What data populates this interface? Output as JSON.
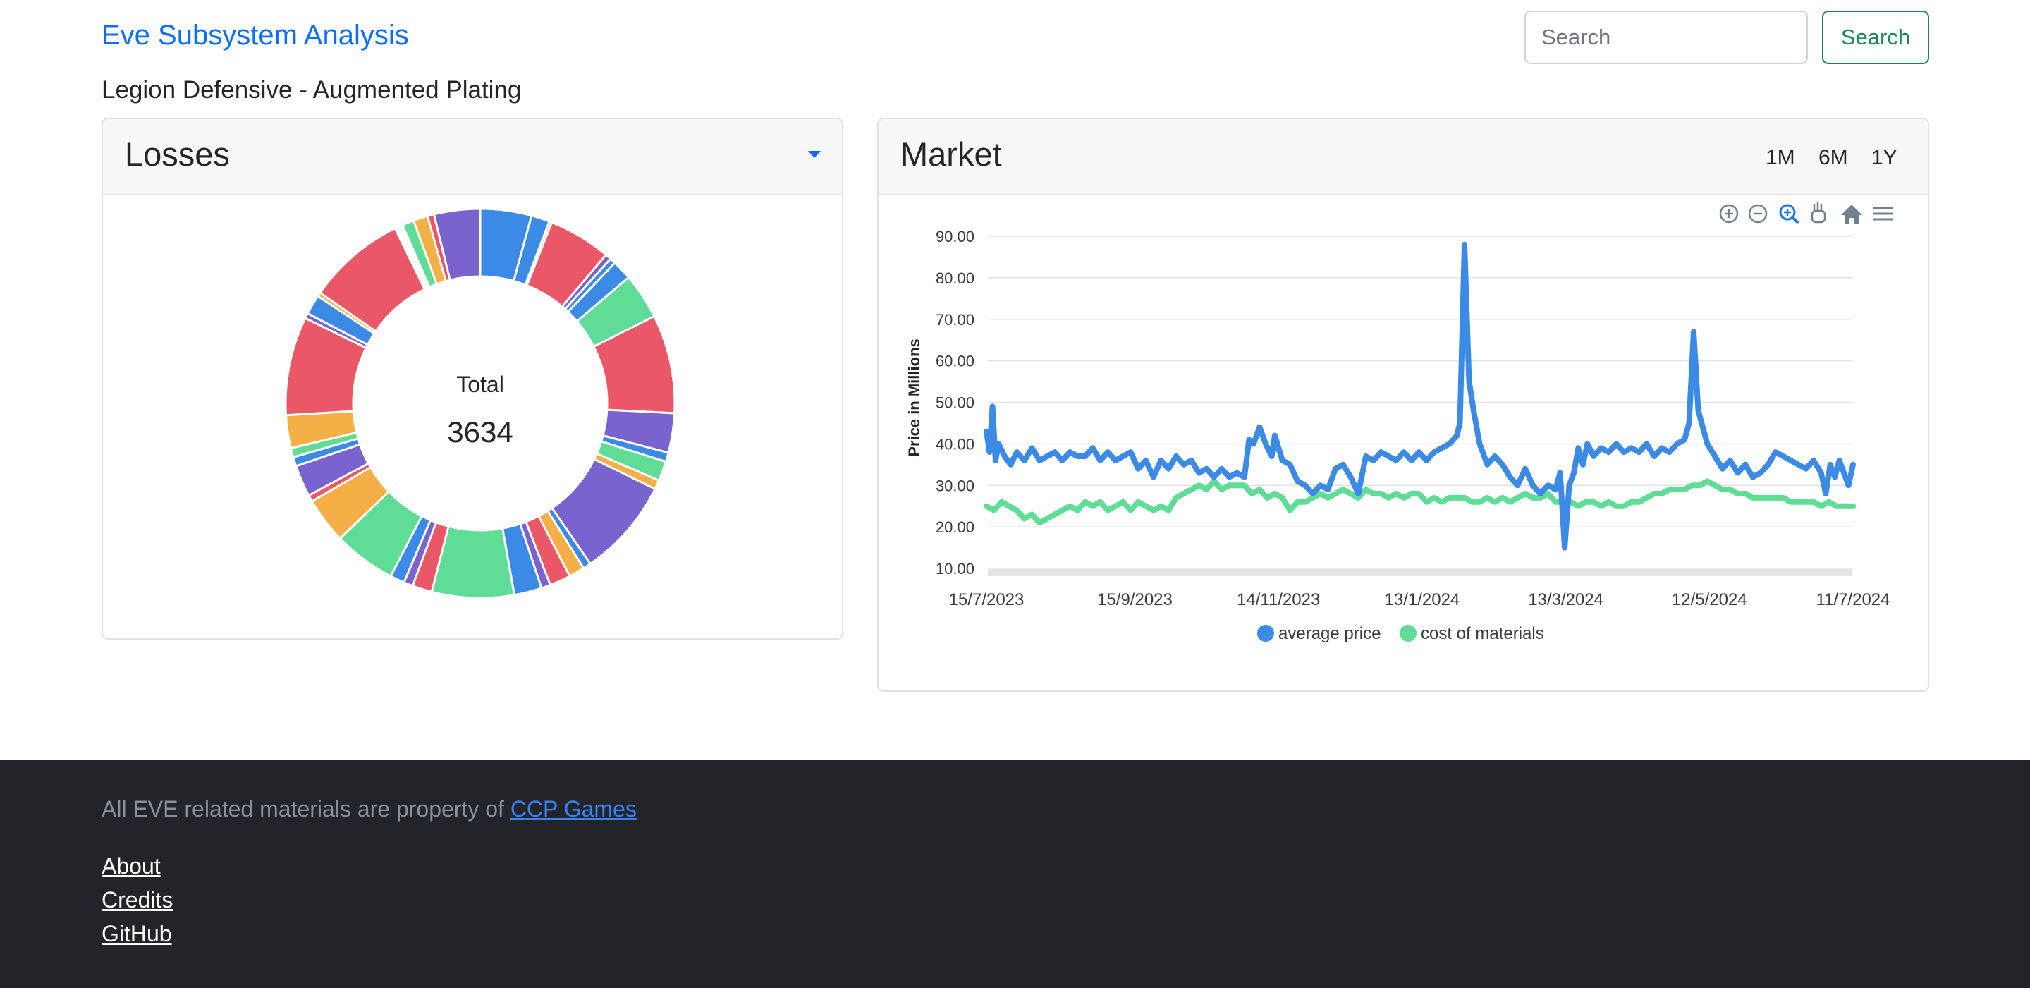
{
  "header": {
    "brand": "Eve Subsystem Analysis",
    "search_placeholder": "Search",
    "search_button": "Search"
  },
  "page_title": "Legion Defensive - Augmented Plating",
  "losses": {
    "title": "Losses",
    "center_label": "Total",
    "total": "3634",
    "colors": [
      "#3b8ae6",
      "#ea5767",
      "#7a62cf",
      "#5fdd96",
      "#f4b046"
    ],
    "segments": [
      {
        "value": 78,
        "color": "#3b8ae6"
      },
      {
        "value": 28,
        "color": "#3b8ae6"
      },
      {
        "value": 4,
        "color": "#f4b046"
      },
      {
        "value": 95,
        "color": "#ea5767"
      },
      {
        "value": 9,
        "color": "#7a62cf"
      },
      {
        "value": 9,
        "color": "#3b8ae6"
      },
      {
        "value": 30,
        "color": "#3b8ae6"
      },
      {
        "value": 70,
        "color": "#5fdd96"
      },
      {
        "value": 150,
        "color": "#ea5767"
      },
      {
        "value": 60,
        "color": "#7a62cf"
      },
      {
        "value": 14,
        "color": "#3b8ae6"
      },
      {
        "value": 30,
        "color": "#5fdd96"
      },
      {
        "value": 14,
        "color": "#f4b046"
      },
      {
        "value": 150,
        "color": "#7a62cf"
      },
      {
        "value": 12,
        "color": "#3b8ae6"
      },
      {
        "value": 24,
        "color": "#f4b046"
      },
      {
        "value": 32,
        "color": "#ea5767"
      },
      {
        "value": 14,
        "color": "#7a62cf"
      },
      {
        "value": 42,
        "color": "#3b8ae6"
      },
      {
        "value": 125,
        "color": "#5fdd96"
      },
      {
        "value": 30,
        "color": "#ea5767"
      },
      {
        "value": 14,
        "color": "#7a62cf"
      },
      {
        "value": 22,
        "color": "#3b8ae6"
      },
      {
        "value": 95,
        "color": "#5fdd96"
      },
      {
        "value": 70,
        "color": "#f4b046"
      },
      {
        "value": 10,
        "color": "#ea5767"
      },
      {
        "value": 48,
        "color": "#7a62cf"
      },
      {
        "value": 14,
        "color": "#3b8ae6"
      },
      {
        "value": 14,
        "color": "#5fdd96"
      },
      {
        "value": 50,
        "color": "#f4b046"
      },
      {
        "value": 150,
        "color": "#ea5767"
      },
      {
        "value": 8,
        "color": "#7a62cf"
      },
      {
        "value": 30,
        "color": "#3b8ae6"
      },
      {
        "value": 6,
        "color": "#f4b046"
      },
      {
        "value": 150,
        "color": "#ea5767"
      },
      {
        "value": 12,
        "color": "#ffffff"
      },
      {
        "value": 18,
        "color": "#5fdd96"
      },
      {
        "value": 22,
        "color": "#f4b046"
      },
      {
        "value": 10,
        "color": "#ea5767"
      },
      {
        "value": 70,
        "color": "#7a62cf"
      }
    ]
  },
  "market": {
    "title": "Market",
    "ranges": [
      "1M",
      "6M",
      "1Y"
    ],
    "toolbar_icons": [
      "zoom-in-icon",
      "zoom-out-icon",
      "zoom-select-icon",
      "pan-hand-icon",
      "home-icon",
      "menu-icon"
    ]
  },
  "chart_data": {
    "type": "line",
    "ylabel": "Price in Millions",
    "ylim": [
      10,
      90
    ],
    "yticks": [
      "90.00",
      "80.00",
      "70.00",
      "60.00",
      "50.00",
      "40.00",
      "30.00",
      "20.00",
      "10.00"
    ],
    "xticks": [
      "15/7/2023",
      "15/9/2023",
      "14/11/2023",
      "13/1/2024",
      "13/3/2024",
      "12/5/2024",
      "11/7/2024"
    ],
    "x_start": "15/7/2023",
    "x_end": "11/7/2024",
    "legend_position": "bottom",
    "series": [
      {
        "name": "average price",
        "color": "#3b8ae6",
        "points": [
          [
            0,
            43
          ],
          [
            2,
            38
          ],
          [
            4,
            49
          ],
          [
            6,
            36
          ],
          [
            8,
            40
          ],
          [
            12,
            37
          ],
          [
            16,
            35
          ],
          [
            20,
            38
          ],
          [
            25,
            36
          ],
          [
            30,
            39
          ],
          [
            35,
            36
          ],
          [
            40,
            37
          ],
          [
            45,
            38
          ],
          [
            50,
            36
          ],
          [
            55,
            38
          ],
          [
            60,
            37
          ],
          [
            65,
            37
          ],
          [
            70,
            39
          ],
          [
            75,
            36
          ],
          [
            80,
            38
          ],
          [
            85,
            36
          ],
          [
            90,
            37
          ],
          [
            95,
            38
          ],
          [
            100,
            34
          ],
          [
            105,
            36
          ],
          [
            110,
            32
          ],
          [
            115,
            36
          ],
          [
            120,
            34
          ],
          [
            125,
            37
          ],
          [
            130,
            35
          ],
          [
            135,
            36
          ],
          [
            140,
            33
          ],
          [
            145,
            34
          ],
          [
            150,
            32
          ],
          [
            155,
            34
          ],
          [
            160,
            32
          ],
          [
            165,
            33
          ],
          [
            170,
            32
          ],
          [
            173,
            41
          ],
          [
            176,
            40
          ],
          [
            180,
            44
          ],
          [
            184,
            40
          ],
          [
            188,
            37
          ],
          [
            190,
            42
          ],
          [
            195,
            36
          ],
          [
            200,
            35
          ],
          [
            205,
            31
          ],
          [
            210,
            30
          ],
          [
            215,
            28
          ],
          [
            220,
            30
          ],
          [
            225,
            29
          ],
          [
            230,
            34
          ],
          [
            235,
            35
          ],
          [
            240,
            32
          ],
          [
            245,
            28
          ],
          [
            250,
            37
          ],
          [
            255,
            36
          ],
          [
            260,
            38
          ],
          [
            265,
            37
          ],
          [
            270,
            36
          ],
          [
            275,
            38
          ],
          [
            280,
            36
          ],
          [
            285,
            38
          ],
          [
            290,
            36
          ],
          [
            295,
            38
          ],
          [
            300,
            39
          ],
          [
            305,
            40
          ],
          [
            310,
            42
          ],
          [
            312,
            45
          ],
          [
            315,
            88
          ],
          [
            318,
            55
          ],
          [
            321,
            48
          ],
          [
            325,
            40
          ],
          [
            330,
            35
          ],
          [
            335,
            37
          ],
          [
            340,
            35
          ],
          [
            345,
            32
          ],
          [
            350,
            30
          ],
          [
            355,
            34
          ],
          [
            360,
            30
          ],
          [
            365,
            28
          ],
          [
            370,
            30
          ],
          [
            375,
            29
          ],
          [
            378,
            33
          ],
          [
            381,
            15
          ],
          [
            384,
            30
          ],
          [
            387,
            33
          ],
          [
            390,
            39
          ],
          [
            393,
            35
          ],
          [
            396,
            40
          ],
          [
            400,
            37
          ],
          [
            405,
            39
          ],
          [
            410,
            38
          ],
          [
            415,
            40
          ],
          [
            420,
            38
          ],
          [
            425,
            39
          ],
          [
            430,
            38
          ],
          [
            435,
            40
          ],
          [
            440,
            37
          ],
          [
            445,
            39
          ],
          [
            450,
            38
          ],
          [
            455,
            40
          ],
          [
            460,
            41
          ],
          [
            463,
            45
          ],
          [
            466,
            67
          ],
          [
            469,
            48
          ],
          [
            472,
            44
          ],
          [
            475,
            40
          ],
          [
            480,
            37
          ],
          [
            485,
            34
          ],
          [
            490,
            36
          ],
          [
            495,
            33
          ],
          [
            500,
            35
          ],
          [
            505,
            32
          ],
          [
            510,
            33
          ],
          [
            515,
            35
          ],
          [
            520,
            38
          ],
          [
            525,
            37
          ],
          [
            530,
            36
          ],
          [
            535,
            35
          ],
          [
            540,
            34
          ],
          [
            545,
            36
          ],
          [
            550,
            33
          ],
          [
            553,
            28
          ],
          [
            556,
            35
          ],
          [
            559,
            32
          ],
          [
            562,
            36
          ],
          [
            565,
            33
          ],
          [
            568,
            30
          ],
          [
            571,
            35
          ]
        ]
      },
      {
        "name": "cost of materials",
        "color": "#5fdd96",
        "points": [
          [
            0,
            25
          ],
          [
            5,
            24
          ],
          [
            10,
            26
          ],
          [
            15,
            25
          ],
          [
            20,
            24
          ],
          [
            25,
            22
          ],
          [
            30,
            23
          ],
          [
            35,
            21
          ],
          [
            40,
            22
          ],
          [
            45,
            23
          ],
          [
            50,
            24
          ],
          [
            55,
            25
          ],
          [
            60,
            24
          ],
          [
            65,
            26
          ],
          [
            70,
            25
          ],
          [
            75,
            26
          ],
          [
            80,
            24
          ],
          [
            85,
            25
          ],
          [
            90,
            26
          ],
          [
            95,
            24
          ],
          [
            100,
            26
          ],
          [
            105,
            25
          ],
          [
            110,
            24
          ],
          [
            115,
            25
          ],
          [
            120,
            24
          ],
          [
            125,
            27
          ],
          [
            130,
            28
          ],
          [
            135,
            29
          ],
          [
            140,
            30
          ],
          [
            145,
            29
          ],
          [
            150,
            31
          ],
          [
            155,
            29
          ],
          [
            160,
            30
          ],
          [
            165,
            30
          ],
          [
            170,
            30
          ],
          [
            175,
            28
          ],
          [
            180,
            29
          ],
          [
            185,
            27
          ],
          [
            190,
            28
          ],
          [
            195,
            27
          ],
          [
            200,
            24
          ],
          [
            205,
            26
          ],
          [
            210,
            26
          ],
          [
            215,
            27
          ],
          [
            220,
            28
          ],
          [
            225,
            27
          ],
          [
            230,
            28
          ],
          [
            235,
            29
          ],
          [
            240,
            28
          ],
          [
            245,
            27
          ],
          [
            250,
            29
          ],
          [
            255,
            28
          ],
          [
            260,
            28
          ],
          [
            265,
            27
          ],
          [
            270,
            28
          ],
          [
            275,
            27
          ],
          [
            280,
            28
          ],
          [
            285,
            28
          ],
          [
            290,
            26
          ],
          [
            295,
            27
          ],
          [
            300,
            26
          ],
          [
            305,
            27
          ],
          [
            310,
            27
          ],
          [
            315,
            27
          ],
          [
            320,
            26
          ],
          [
            325,
            26
          ],
          [
            330,
            27
          ],
          [
            335,
            26
          ],
          [
            340,
            27
          ],
          [
            345,
            26
          ],
          [
            350,
            27
          ],
          [
            355,
            28
          ],
          [
            360,
            27
          ],
          [
            365,
            27
          ],
          [
            370,
            28
          ],
          [
            375,
            26
          ],
          [
            380,
            26
          ],
          [
            385,
            26
          ],
          [
            390,
            25
          ],
          [
            395,
            26
          ],
          [
            400,
            26
          ],
          [
            405,
            25
          ],
          [
            410,
            26
          ],
          [
            415,
            25
          ],
          [
            420,
            25
          ],
          [
            425,
            26
          ],
          [
            430,
            26
          ],
          [
            435,
            27
          ],
          [
            440,
            28
          ],
          [
            445,
            28
          ],
          [
            450,
            29
          ],
          [
            455,
            29
          ],
          [
            460,
            29
          ],
          [
            465,
            30
          ],
          [
            470,
            30
          ],
          [
            475,
            31
          ],
          [
            480,
            30
          ],
          [
            485,
            29
          ],
          [
            490,
            29
          ],
          [
            495,
            28
          ],
          [
            500,
            28
          ],
          [
            505,
            27
          ],
          [
            510,
            27
          ],
          [
            515,
            27
          ],
          [
            520,
            27
          ],
          [
            525,
            27
          ],
          [
            530,
            26
          ],
          [
            535,
            26
          ],
          [
            540,
            26
          ],
          [
            545,
            26
          ],
          [
            550,
            25
          ],
          [
            555,
            26
          ],
          [
            560,
            25
          ],
          [
            565,
            25
          ],
          [
            571,
            25
          ]
        ]
      }
    ]
  },
  "footer": {
    "text_prefix": "All EVE related materials are property of",
    "ccp_link": "CCP Games",
    "links": [
      "About",
      "Credits",
      "GitHub"
    ]
  }
}
